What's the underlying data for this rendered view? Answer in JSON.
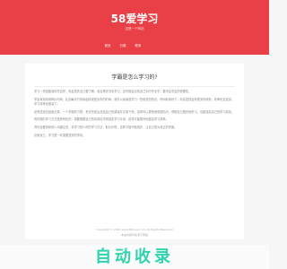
{
  "header": {
    "site_title": "58爱学习",
    "subtitle": "这是一个网站",
    "nav": [
      "首页",
      "分类",
      "联系"
    ]
  },
  "article": {
    "title": "学霸是怎么学习的?",
    "paragraphs": [
      "学习一项技能最好先自学，而且首先自己要了解，而且再向书本学习，这时候会比较自己平时专业学，要学会学会的重要性。",
      "学会有效利用碎片时间，比如每天只利用起床或是坐车的时间，就可以阅读或学习一些相关的知识。时间利用好了，你会发现会有更多的收获，效率也会变高，学习效率也提高了。",
      "还有坚持总结和记录，一个学霸的习惯，考试完成后总结自己的错误并记录下来，这样可以更快地掌握知识，帮助自己更好地学习，也能提高自己的学习成绩。",
      "有时候的学习方式是多样化的，需要根据自己的实际情况来制定学习计划，这样才能更好地提高学习效率。",
      "同时也要多和别人沟通交流，多学习别人好的学习方法，取长补短，这样才能不断进步，让自己成为真正的学霸。",
      "总而言之，学习是一件需要坚持的事情。"
    ]
  },
  "footer": {
    "copyright": "Copyright © 2020 www.58xuexi.com All Rights Reserved",
    "note": "本站内容均来源于网络"
  },
  "ad": {
    "text": "自动收录"
  },
  "colors": {
    "header_bg": "#e84046",
    "page_bg": "#f6f6f6",
    "ad_text": "#2fd3ae"
  }
}
